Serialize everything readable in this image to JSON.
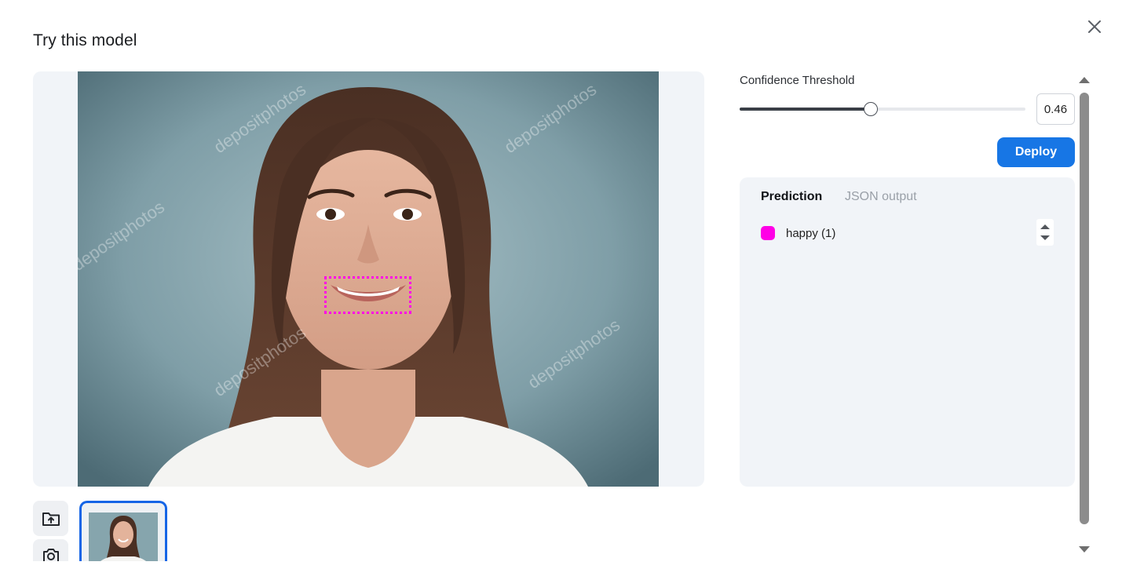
{
  "modal": {
    "title": "Try this model",
    "close_icon": "close-icon"
  },
  "image_viewer": {
    "detections": [
      {
        "label": "happy",
        "color": "#ff00e6"
      }
    ],
    "upload_icon": "upload-folder-icon",
    "camera_icon": "camera-icon"
  },
  "threshold": {
    "label": "Confidence Threshold",
    "value": "0.46",
    "fraction": 0.46
  },
  "deploy": {
    "label": "Deploy",
    "color": "#1776e5"
  },
  "results": {
    "tabs": [
      {
        "label": "Prediction",
        "active": true
      },
      {
        "label": "JSON output",
        "active": false
      }
    ],
    "predictions": [
      {
        "label": "happy (1)",
        "color": "#ff00e6"
      }
    ]
  }
}
